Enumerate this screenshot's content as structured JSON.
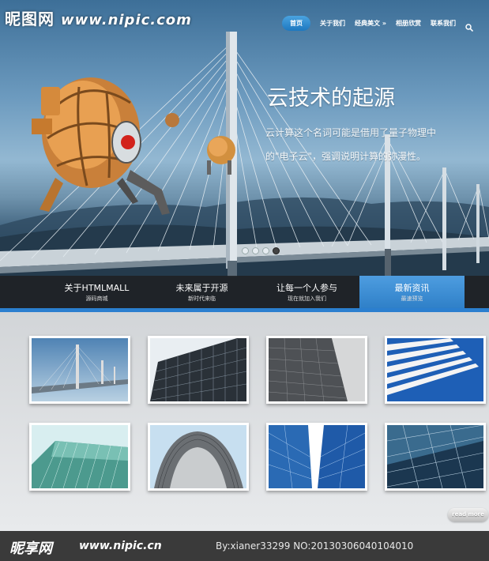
{
  "watermark_top": {
    "logo": "昵图网",
    "url": "www.nipic.com"
  },
  "nav": {
    "items": [
      {
        "label": "首页"
      },
      {
        "label": "关于我们"
      },
      {
        "label": "经典美文 »"
      },
      {
        "label": "相册欣赏"
      },
      {
        "label": "联系我们"
      }
    ],
    "search_icon": "search-icon"
  },
  "hero": {
    "headline": "云技术的起源",
    "subline_1": "云计算这个名词可能是借用了量子物理中",
    "subline_2": "的\"电子云\"，强调说明计算的弥漫性。",
    "slides": 4,
    "active_slide": 4
  },
  "tabs": [
    {
      "title": "关于HTMLMALL",
      "subtitle": "源码商城"
    },
    {
      "title": "未来属于开源",
      "subtitle": "新时代来临"
    },
    {
      "title": "让每一个人参与",
      "subtitle": "现在就加入我们"
    },
    {
      "title": "最新资讯",
      "subtitle": "最速预览",
      "active": true
    }
  ],
  "gallery": {
    "thumbnails": [
      {
        "name": "bridge-thumbnail"
      },
      {
        "name": "glass-tower-thumbnail"
      },
      {
        "name": "grey-tower-thumbnail"
      },
      {
        "name": "white-facade-thumbnail"
      },
      {
        "name": "green-glass-thumbnail"
      },
      {
        "name": "dome-thumbnail"
      },
      {
        "name": "blue-skyscrapers-thumbnail"
      },
      {
        "name": "glass-wall-thumbnail"
      }
    ],
    "readmore": "read more"
  },
  "footer": {
    "logo": "昵享网",
    "url": "www.nipic.cn",
    "id_text": "By:xianer33299 NO:20130306040104010"
  },
  "colors": {
    "accent": "#2b7fcf",
    "tab_active": "#4e9de0",
    "tab_bar": "#1e2022"
  }
}
